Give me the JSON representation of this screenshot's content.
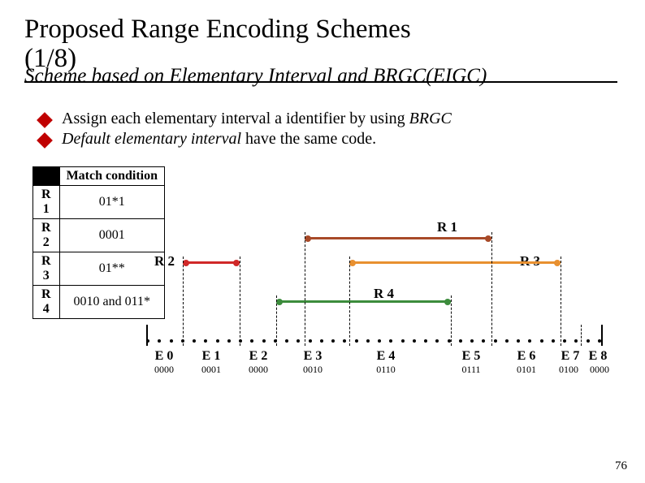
{
  "title_line1": "Proposed Range Encoding Schemes",
  "title_line2": "(1/8)",
  "subtitle": "Scheme based on Elementary Interval and BRGC(EIGC)",
  "bullets": [
    {
      "prefix": "Assign each elementary interval a identifier by using ",
      "italic_tail": "BRGC"
    },
    {
      "italic_head": "Default elementary interval",
      "suffix": " have the same code."
    }
  ],
  "table": {
    "header": "Match condition",
    "rows": [
      {
        "r": "R 1",
        "m": "01*1"
      },
      {
        "r": "R 2",
        "m": "0001"
      },
      {
        "r": "R 3",
        "m": "01**"
      },
      {
        "r": "R 4",
        "m": "0010  and  011*"
      }
    ]
  },
  "ranges": {
    "r1": "R 1",
    "r2": "R 2",
    "r3": "R 3",
    "r4": "R 4"
  },
  "intervals": [
    {
      "label": "E 0",
      "code": "0000"
    },
    {
      "label": "E 1",
      "code": "0001"
    },
    {
      "label": "E 2",
      "code": "0000"
    },
    {
      "label": "E 3",
      "code": "0010"
    },
    {
      "label": "E 4",
      "code": "0110"
    },
    {
      "label": "E 5",
      "code": "0111"
    },
    {
      "label": "E 6",
      "code": "0101"
    },
    {
      "label": "E 7",
      "code": "0100"
    },
    {
      "label": "E 8",
      "code": "0000"
    }
  ],
  "page": "76",
  "chart_data": {
    "type": "table",
    "title": "EIGC elementary intervals with BRGC identifiers and range match conditions",
    "intervals": [
      {
        "name": "E0",
        "brgc": "0000"
      },
      {
        "name": "E1",
        "brgc": "0001"
      },
      {
        "name": "E2",
        "brgc": "0000"
      },
      {
        "name": "E3",
        "brgc": "0010"
      },
      {
        "name": "E4",
        "brgc": "0110"
      },
      {
        "name": "E5",
        "brgc": "0111"
      },
      {
        "name": "E6",
        "brgc": "0101"
      },
      {
        "name": "E7",
        "brgc": "0100"
      },
      {
        "name": "E8",
        "brgc": "0000"
      }
    ],
    "ranges": [
      {
        "name": "R1",
        "span_from": "E3",
        "span_to": "E6",
        "match": "01*1"
      },
      {
        "name": "R2",
        "span_from": "E1",
        "span_to": "E1",
        "match": "0001"
      },
      {
        "name": "R3",
        "span_from": "E4",
        "span_to": "E7",
        "match": "01**"
      },
      {
        "name": "R4",
        "span_from": "E3",
        "span_to": "E5",
        "match": "0010 and 011*"
      }
    ]
  }
}
